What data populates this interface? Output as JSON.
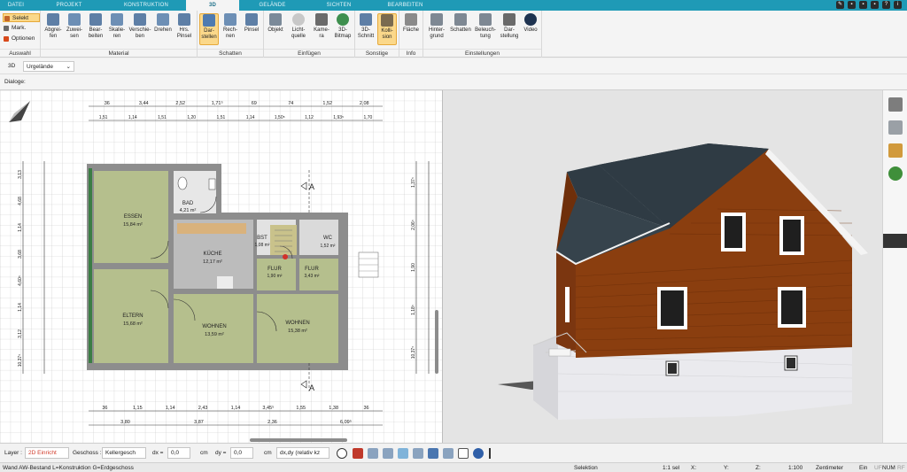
{
  "tabs": [
    "DATEI",
    "PROJEKT",
    "KONSTRUKTION",
    "3D",
    "GELÄNDE",
    "SICHTEN",
    "BEARBEITEN"
  ],
  "active_tab": "3D",
  "ribbon": {
    "auswahl": {
      "items": [
        "Selekt",
        "Mark.",
        "Optionen"
      ],
      "label": "Auswahl"
    },
    "material": {
      "buttons": [
        "Abgrei-\nfen",
        "Zuwei-\nsen",
        "Bear-\nbeiten",
        "Skalie-\nren",
        "Verschie-\nben",
        "Drehen",
        "Hrs.\nPinsel"
      ],
      "label": "Material"
    },
    "schatten": {
      "buttons": [
        "Dar-\nstellen",
        "Rech-\nnen",
        "Pinsel"
      ],
      "label": "Schatten"
    },
    "einfuegen": {
      "buttons": [
        "Objekt",
        "Licht-\nquelle",
        "Kame-\nra",
        "3D-\nBitmap"
      ],
      "label": "Einfügen"
    },
    "sonstige": {
      "buttons": [
        "3D-\nSchnitt",
        "Kolli-\nsion"
      ],
      "label": "Sonstige"
    },
    "info": {
      "buttons": [
        "Fläche"
      ],
      "label": "Info"
    },
    "einstellungen": {
      "buttons": [
        "Hinter-\ngrund",
        "Schatten",
        "Beleuch-\ntung",
        "Dar-\nstellung",
        "Video"
      ],
      "label": "Einstellungen"
    }
  },
  "subbar": {
    "mode": "3D",
    "terrain": "Urgelände",
    "dialog_label": "Dialoge:"
  },
  "plan": {
    "rooms": [
      {
        "name": "ESSEN",
        "area": "15,84 m²"
      },
      {
        "name": "BAD",
        "area": "4,21 m²"
      },
      {
        "name": "KÜCHE",
        "area": "12,17 m²"
      },
      {
        "name": "ELTERN",
        "area": "15,68 m²"
      },
      {
        "name": "WOHNEN",
        "area": "13,59 m²"
      },
      {
        "name": "WOHNEN",
        "area": "15,38 m²"
      },
      {
        "name": "FLUR",
        "area": "1,90 m²"
      },
      {
        "name": "FLUR",
        "area": "3,43 m²"
      },
      {
        "name": "WC",
        "area": "1,52 m²"
      },
      {
        "name": "BST",
        "area": "1,08 m²"
      }
    ],
    "dims_top1": [
      "36",
      "3,44",
      "2,52",
      "1,71⁵",
      "69",
      "74",
      "1,52",
      "2,08"
    ],
    "dims_top2": [
      "1,51",
      "1,14",
      "1,51",
      "1,20",
      "1,51",
      "1,14",
      "1,50⁵",
      "1,12",
      "1,93⁵",
      "1,70"
    ],
    "dims_bottom1": [
      "36",
      "1,15",
      "1,14",
      "2,43",
      "1,14",
      "3,45⁵",
      "1,55",
      "1,38",
      "36"
    ],
    "dims_bottom2": [
      "3,80",
      "3,87",
      "2,36",
      "6,09⁵"
    ],
    "dims_left": [
      "3,13",
      "4,68",
      "1,14",
      "3,68",
      "4,60⁵",
      "1,14",
      "3,12",
      "10,37⁵"
    ],
    "dims_right": [
      "1,37⁵",
      "2,06⁵",
      "1,90",
      "1,18⁵",
      "10,37⁵"
    ],
    "section_marker": "A"
  },
  "statusbar": {
    "layer_label": "Layer :",
    "layer_value": "2D Einricht",
    "geschoss_label": "Geschoss :",
    "geschoss_value": "Kellergesch",
    "dx_label": "dx =",
    "dx_value": "0,0",
    "dx_unit": "cm",
    "dy_label": "dy =",
    "dy_value": "0,0",
    "dy_unit": "cm",
    "mode_value": "dx,dy (relativ kz"
  },
  "bottombar": {
    "info": "Wand AW-Bestand L=Konstruktion G=Erdgeschoss",
    "mode": "Selektion",
    "count": "1:1 sel",
    "x": "X:",
    "y": "Y:",
    "z": "Z:",
    "scale": "1:100",
    "unit": "Zentimeter",
    "ein": "Ein",
    "uf": "UF",
    "num": "NUM",
    "rf": "RF"
  },
  "colors": {
    "accent": "#1f9ab6",
    "room": "#b5bf8d",
    "wall": "#8d8d8d",
    "facade": "#8a3e0f",
    "roof": "#2f3b44"
  }
}
